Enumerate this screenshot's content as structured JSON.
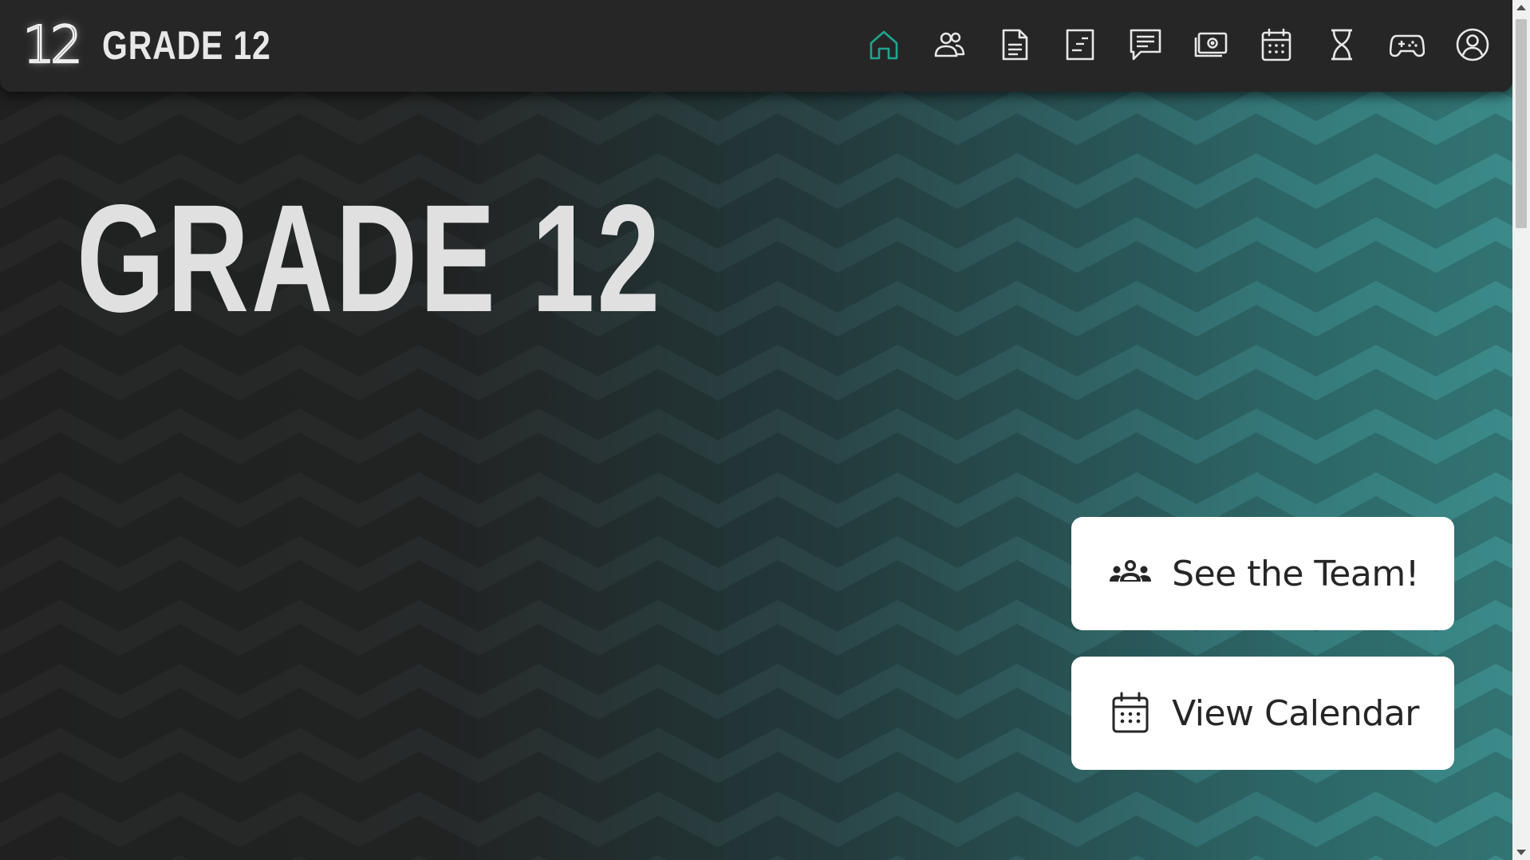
{
  "nav": {
    "brand_mark": "12",
    "brand_title": "GRADE 12",
    "icons": [
      {
        "name": "home-icon",
        "active": true
      },
      {
        "name": "team-icon",
        "active": false
      },
      {
        "name": "document-icon",
        "active": false
      },
      {
        "name": "notes-icon",
        "active": false
      },
      {
        "name": "chat-icon",
        "active": false
      },
      {
        "name": "money-icon",
        "active": false
      },
      {
        "name": "calendar-icon",
        "active": false
      },
      {
        "name": "hourglass-icon",
        "active": false
      },
      {
        "name": "gamepad-icon",
        "active": false
      },
      {
        "name": "profile-icon",
        "active": false
      }
    ],
    "active_color": "#1fa58f",
    "icon_color": "#e8e8e8"
  },
  "hero": {
    "title": "GRADE 12"
  },
  "actions": {
    "team_label": "See the Team!",
    "team_icon": "people-group-icon",
    "calendar_label": "View Calendar",
    "calendar_icon": "calendar-icon"
  },
  "colors": {
    "background_dark": "#262626",
    "gradient_teal": "#3b8a89",
    "button_bg": "#ffffff",
    "button_text": "#262626"
  }
}
